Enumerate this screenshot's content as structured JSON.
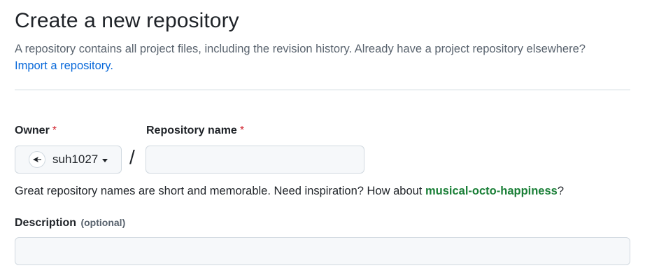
{
  "header": {
    "title": "Create a new repository",
    "description": "A repository contains all project files, including the revision history. Already have a project repository elsewhere?",
    "import_link": "Import a repository."
  },
  "form": {
    "owner": {
      "label": "Owner",
      "required_mark": "*",
      "selected": "suh1027"
    },
    "separator": "/",
    "repo_name": {
      "label": "Repository name",
      "required_mark": "*",
      "value": "",
      "placeholder": ""
    },
    "suggestion": {
      "prefix": "Great repository names are short and memorable. Need inspiration? How about ",
      "name": "musical-octo-happiness",
      "suffix": "?"
    },
    "description": {
      "label": "Description",
      "optional": "(optional)",
      "value": "",
      "placeholder": ""
    }
  },
  "colors": {
    "link": "#0969da",
    "required": "#d1242f",
    "suggestion": "#1a7f37",
    "input_bg": "#f6f8fa",
    "border": "#d1d9e0"
  },
  "icons": {
    "avatar": "avatar-icon",
    "caret": "caret-down-icon"
  }
}
